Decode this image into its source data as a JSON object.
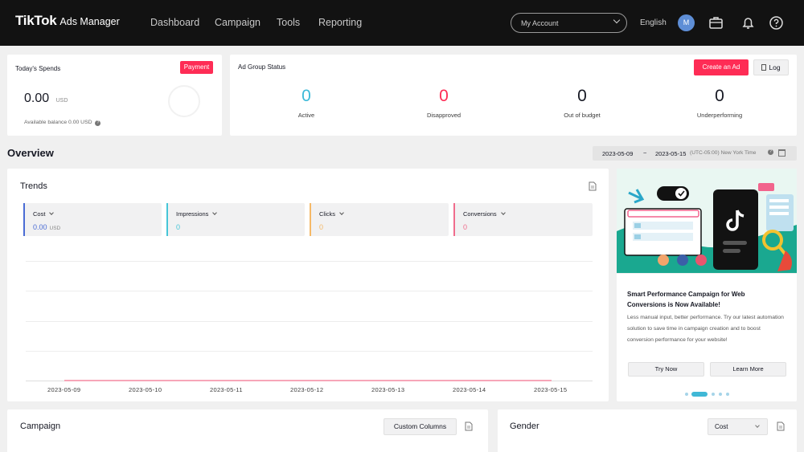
{
  "header": {
    "logo": "TikTok",
    "logo_sub": "Ads Manager",
    "nav": [
      "Dashboard",
      "Campaign",
      "Tools",
      "Reporting"
    ],
    "account": "My Account",
    "language": "English",
    "avatar_initial": "M"
  },
  "spends": {
    "title": "Today's Spends",
    "payment_label": "Payment",
    "amount": "0.00",
    "currency": "USD",
    "balance": "Available balance 0.00 USD"
  },
  "adgroup": {
    "title": "Ad Group Status",
    "create_label": "Create an Ad",
    "log_label": "Log",
    "stats": [
      {
        "value": "0",
        "label": "Active",
        "color": "#3bb9d8"
      },
      {
        "value": "0",
        "label": "Disapproved",
        "color": "#fe2c55"
      },
      {
        "value": "0",
        "label": "Out of budget",
        "color": "#161823"
      },
      {
        "value": "0",
        "label": "Underperforming",
        "color": "#161823"
      }
    ]
  },
  "overview": {
    "title": "Overview",
    "date_start": "2023-05-09",
    "date_sep": "~",
    "date_end": "2023-05-15",
    "timezone": "(UTC-05:00) New York Time"
  },
  "trends": {
    "title": "Trends",
    "metrics": [
      {
        "name": "Cost",
        "value": "0.00",
        "unit": "USD",
        "color": "#4a6cd4"
      },
      {
        "name": "Impressions",
        "value": "0",
        "unit": "",
        "color": "#46c6d8"
      },
      {
        "name": "Clicks",
        "value": "0",
        "unit": "",
        "color": "#f5b967"
      },
      {
        "name": "Conversions",
        "value": "0",
        "unit": "",
        "color": "#f06c8c"
      }
    ],
    "dates": [
      "2023-05-09",
      "2023-05-10",
      "2023-05-11",
      "2023-05-12",
      "2023-05-13",
      "2023-05-14",
      "2023-05-15"
    ]
  },
  "promo": {
    "title": "Smart Performance Campaign for Web Conversions is Now Available!",
    "description": "Less manual input, better performance. Try our latest automation solution to save time in campaign creation and to boost conversion performance for your website!",
    "try_label": "Try Now",
    "learn_label": "Learn More"
  },
  "campaign": {
    "title": "Campaign",
    "custom_columns_label": "Custom Columns"
  },
  "gender": {
    "title": "Gender",
    "select_value": "Cost"
  }
}
